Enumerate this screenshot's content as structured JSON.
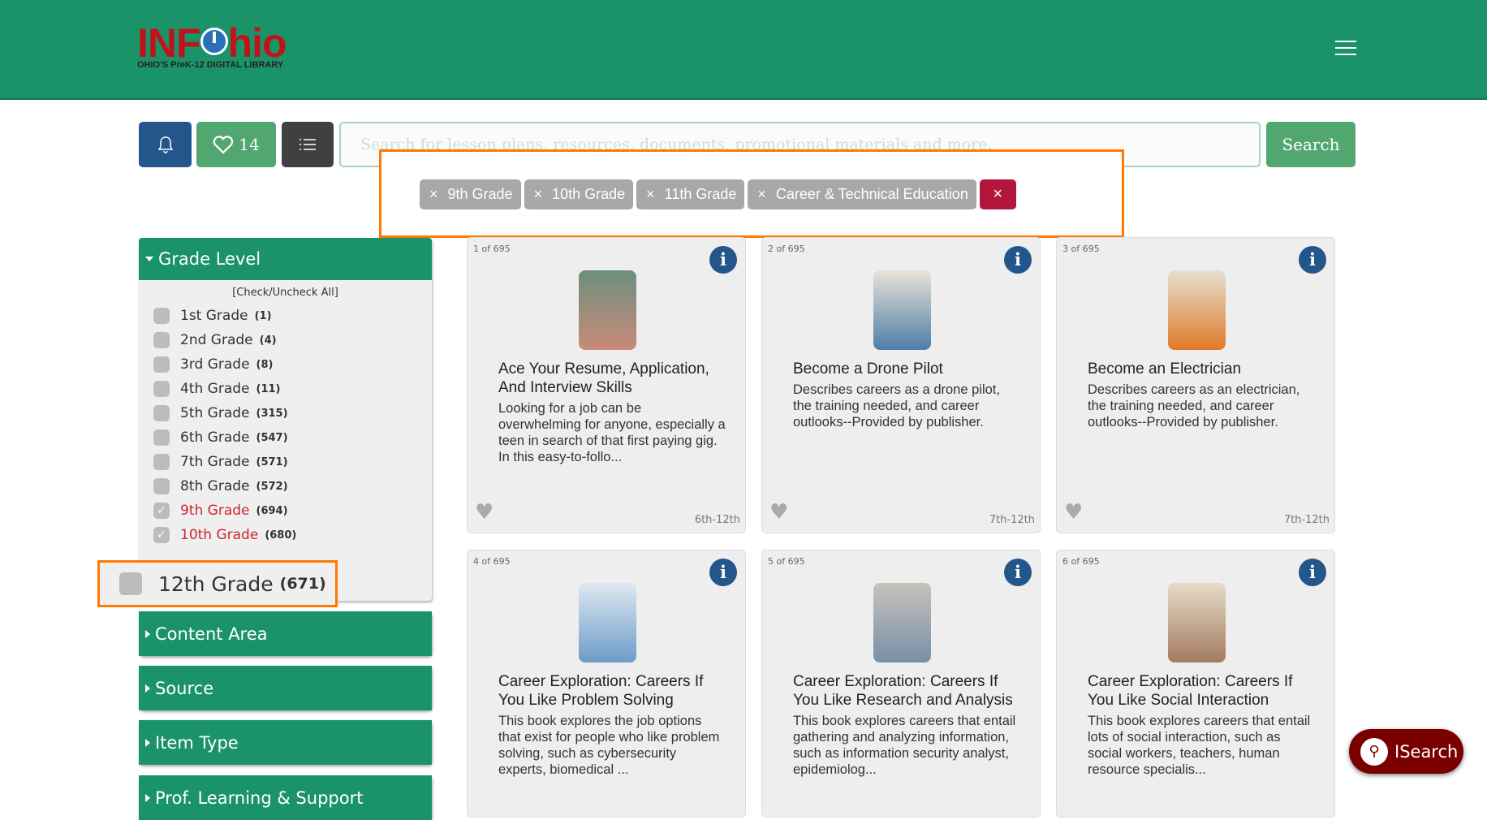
{
  "header": {
    "logo_text": "INFOhio",
    "logo_subtitle": "OHIO'S PreK-12 DIGITAL LIBRARY",
    "menu_icon": "hamburger-icon"
  },
  "toolbar": {
    "favorites_count": "14",
    "search_placeholder": "Search for lesson plans, resources, documents, promotional materials and more.",
    "search_value": "",
    "search_label": "Search"
  },
  "filters": {
    "chips": [
      "9th Grade",
      "10th Grade",
      "11th Grade",
      "Career & Technical Education"
    ],
    "close_glyph": "×"
  },
  "sidebar": {
    "grade_level": {
      "title": "Grade Level",
      "check_all": "[Check/Uncheck All]",
      "items": [
        {
          "label": "1st Grade",
          "count": "(1)",
          "checked": false
        },
        {
          "label": "2nd Grade",
          "count": "(4)",
          "checked": false
        },
        {
          "label": "3rd Grade",
          "count": "(8)",
          "checked": false
        },
        {
          "label": "4th Grade",
          "count": "(11)",
          "checked": false
        },
        {
          "label": "5th Grade",
          "count": "(315)",
          "checked": false
        },
        {
          "label": "6th Grade",
          "count": "(547)",
          "checked": false
        },
        {
          "label": "7th Grade",
          "count": "(571)",
          "checked": false
        },
        {
          "label": "8th Grade",
          "count": "(572)",
          "checked": false
        },
        {
          "label": "9th Grade",
          "count": "(694)",
          "checked": true
        },
        {
          "label": "10th Grade",
          "count": "(680)",
          "checked": true
        }
      ],
      "highlight": {
        "label": "12th Grade",
        "count": "(671)",
        "checked": false
      }
    },
    "sections": [
      "Content Area",
      "Source",
      "Item Type",
      "Prof. Learning & Support"
    ]
  },
  "cards": [
    {
      "index": "1 of 695",
      "title": "Ace Your Resume, Application, And Interview Skills",
      "desc": "Looking for a job can be overwhelming for anyone, especially a teen in search of that first paying gig. In this easy-to-follo...",
      "grades": "6th-12th"
    },
    {
      "index": "2 of 695",
      "title": "Become a Drone Pilot",
      "desc": "Describes careers as a drone pilot, the training needed, and career outlooks--Provided by publisher.",
      "grades": "7th-12th"
    },
    {
      "index": "3 of 695",
      "title": "Become an Electrician",
      "desc": "Describes careers as an electrician, the training needed, and career outlooks--Provided by publisher.",
      "grades": "7th-12th"
    },
    {
      "index": "4 of 695",
      "title": "Career Exploration: Careers If You Like Problem Solving",
      "desc": "This book explores the job options that exist for people who like problem solving, such as cybersecurity experts, biomedical ...",
      "grades": ""
    },
    {
      "index": "5 of 695",
      "title": "Career Exploration: Careers If You Like Research and Analysis",
      "desc": "This book explores careers that entail gathering and analyzing information, such as information security analyst, epidemiolog...",
      "grades": ""
    },
    {
      "index": "6 of 695",
      "title": "Career Exploration: Careers If You Like Social Interaction",
      "desc": "This book explores careers that entail lots of social interaction, such as social workers, teachers, human resource specialis...",
      "grades": ""
    }
  ],
  "isearch": {
    "label": "ISearch"
  },
  "colors": {
    "brand_green": "#1a9369",
    "button_green": "#52a771",
    "navy": "#23568a",
    "highlight": "#ff7a00",
    "clear_red": "#b3163d",
    "isearch_red": "#7a0000"
  }
}
